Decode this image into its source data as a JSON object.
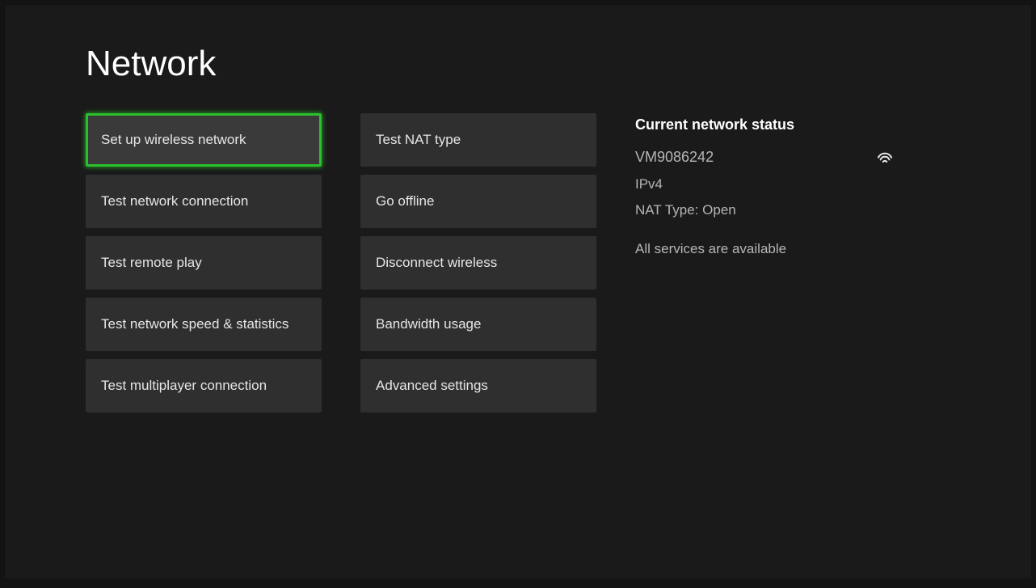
{
  "title": "Network",
  "leftColumn": [
    {
      "label": "Set up wireless network",
      "selected": true
    },
    {
      "label": "Test network connection",
      "selected": false
    },
    {
      "label": "Test remote play",
      "selected": false
    },
    {
      "label": "Test network speed & statistics",
      "selected": false
    },
    {
      "label": "Test multiplayer connection",
      "selected": false
    }
  ],
  "rightColumn": [
    {
      "label": "Test NAT type",
      "selected": false
    },
    {
      "label": "Go offline",
      "selected": false
    },
    {
      "label": "Disconnect wireless",
      "selected": false
    },
    {
      "label": "Bandwidth usage",
      "selected": false
    },
    {
      "label": "Advanced settings",
      "selected": false
    }
  ],
  "status": {
    "heading": "Current network status",
    "ssid": "VM9086242",
    "ipVersion": "IPv4",
    "natType": "NAT Type: Open",
    "services": "All services are available"
  }
}
